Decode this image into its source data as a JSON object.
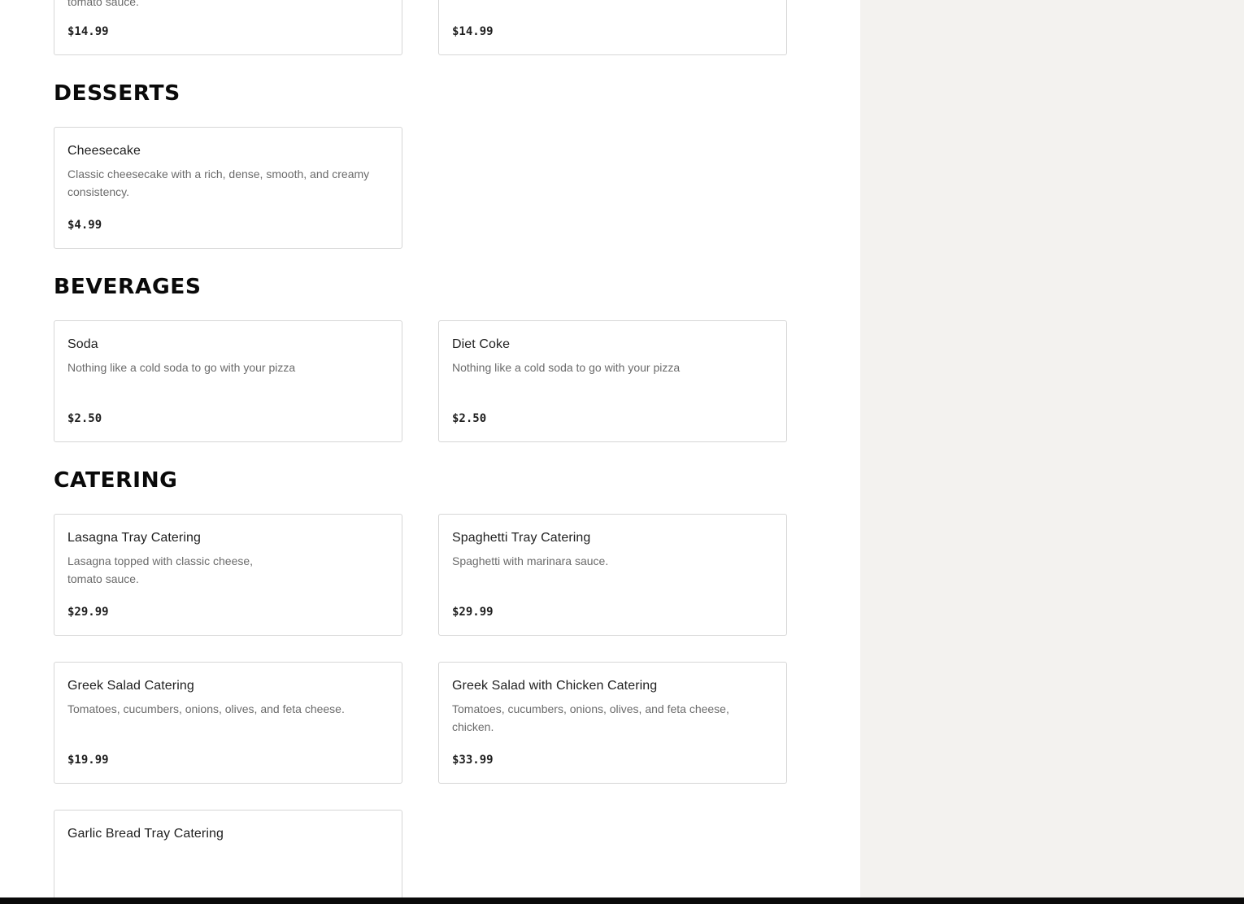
{
  "top_cards": [
    {
      "desc_partial": "tomato sauce.",
      "price": "$14.99"
    },
    {
      "price": "$14.99"
    }
  ],
  "sections": {
    "desserts": {
      "title": "DESSERTS",
      "items": [
        {
          "name": "Cheesecake",
          "desc": "Classic cheesecake with a rich, dense, smooth, and creamy consistency.",
          "price": "$4.99"
        }
      ]
    },
    "beverages": {
      "title": "BEVERAGES",
      "items": [
        {
          "name": "Soda",
          "desc": "Nothing like a cold soda to go with your pizza",
          "price": "$2.50"
        },
        {
          "name": "Diet Coke",
          "desc": "Nothing like a cold soda to go with your pizza",
          "price": "$2.50"
        }
      ]
    },
    "catering": {
      "title": "CATERING",
      "items": [
        {
          "name": "Lasagna Tray Catering",
          "desc_line1": "Lasagna topped with classic cheese,",
          "desc_line2": "tomato sauce.",
          "price": "$29.99"
        },
        {
          "name": "Spaghetti Tray Catering",
          "desc": "Spaghetti with marinara sauce.",
          "price": "$29.99"
        },
        {
          "name": "Greek Salad Catering",
          "desc": "Tomatoes, cucumbers, onions, olives, and feta cheese.",
          "price": "$19.99"
        },
        {
          "name": "Greek Salad with Chicken Catering",
          "desc": "Tomatoes, cucumbers, onions, olives, and feta cheese, chicken.",
          "price": "$33.99"
        },
        {
          "name": "Garlic Bread Tray Catering"
        }
      ]
    }
  },
  "colors": {
    "side_panel": "#f3f2ef",
    "card_border": "#d6d6d6",
    "bottom_bar": "#0a0a0a"
  }
}
